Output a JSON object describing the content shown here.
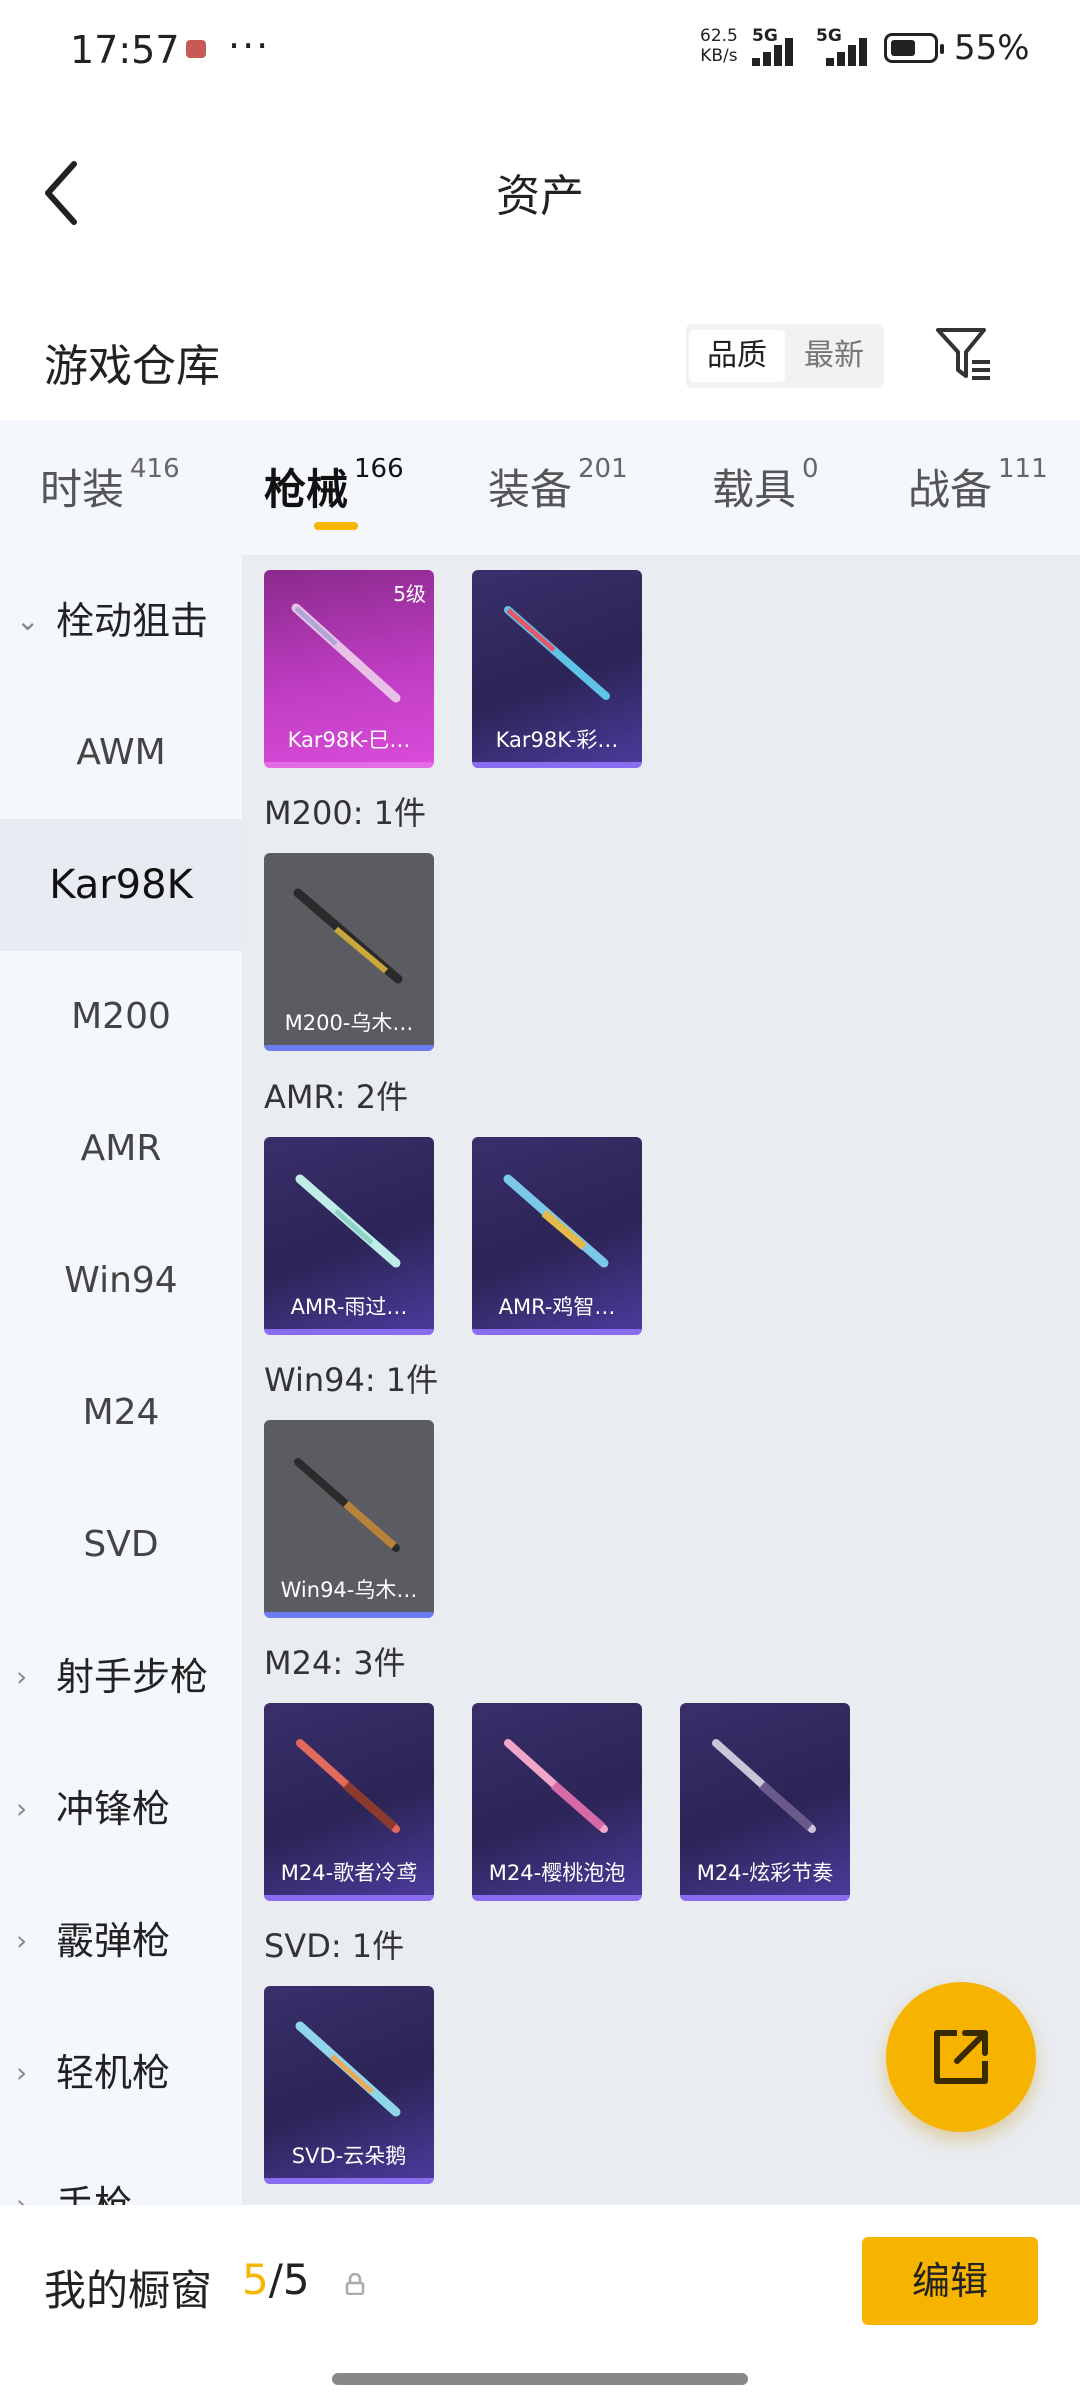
{
  "status": {
    "time": "17:57",
    "net_speed": [
      "62.5",
      "KB/s"
    ],
    "signal1": "5G",
    "signal2": "5G",
    "battery": "55%"
  },
  "nav": {
    "title": "资产"
  },
  "warehouse": {
    "label": "游戏仓库",
    "sort_quality": "品质",
    "sort_latest": "最新"
  },
  "tabs": [
    {
      "label": "时装",
      "count": "416"
    },
    {
      "label": "枪械",
      "count": "166"
    },
    {
      "label": "装备",
      "count": "201"
    },
    {
      "label": "载具",
      "count": "0"
    },
    {
      "label": "战备",
      "count": "111"
    }
  ],
  "sidebar": [
    {
      "label": "栓动狙击",
      "type": "category"
    },
    {
      "label": "AWM"
    },
    {
      "label": "Kar98K",
      "selected": true
    },
    {
      "label": "M200"
    },
    {
      "label": "AMR"
    },
    {
      "label": "Win94"
    },
    {
      "label": "M24"
    },
    {
      "label": "SVD"
    },
    {
      "label": "射手步枪",
      "type": "category"
    },
    {
      "label": "冲锋枪",
      "type": "category"
    },
    {
      "label": "霰弹枪",
      "type": "category"
    },
    {
      "label": "轻机枪",
      "type": "category"
    },
    {
      "label": "手枪",
      "type": "category"
    }
  ],
  "groups": [
    {
      "title": "",
      "items": [
        {
          "name": "Kar98K-巳…",
          "level": "5级",
          "style": "pink"
        },
        {
          "name": "Kar98K-彩…",
          "style": "purple"
        }
      ]
    },
    {
      "title": "M200: 1件",
      "items": [
        {
          "name": "M200-乌木…",
          "style": "gray"
        }
      ]
    },
    {
      "title": "AMR: 2件",
      "items": [
        {
          "name": "AMR-雨过…",
          "style": "purple"
        },
        {
          "name": "AMR-鸡智…",
          "style": "purple"
        }
      ]
    },
    {
      "title": "Win94: 1件",
      "items": [
        {
          "name": "Win94-乌木…",
          "style": "gray"
        }
      ]
    },
    {
      "title": "M24: 3件",
      "items": [
        {
          "name": "M24-歌者冷鸢",
          "style": "purple"
        },
        {
          "name": "M24-樱桃泡泡",
          "style": "purple"
        },
        {
          "name": "M24-炫彩节奏",
          "style": "purple"
        }
      ]
    },
    {
      "title": "SVD: 1件",
      "items": [
        {
          "name": "SVD-云朵鹅",
          "style": "purple"
        }
      ]
    }
  ],
  "bottom": {
    "label": "我的橱窗",
    "count_a": "5",
    "count_b": "/5",
    "edit": "编辑"
  }
}
